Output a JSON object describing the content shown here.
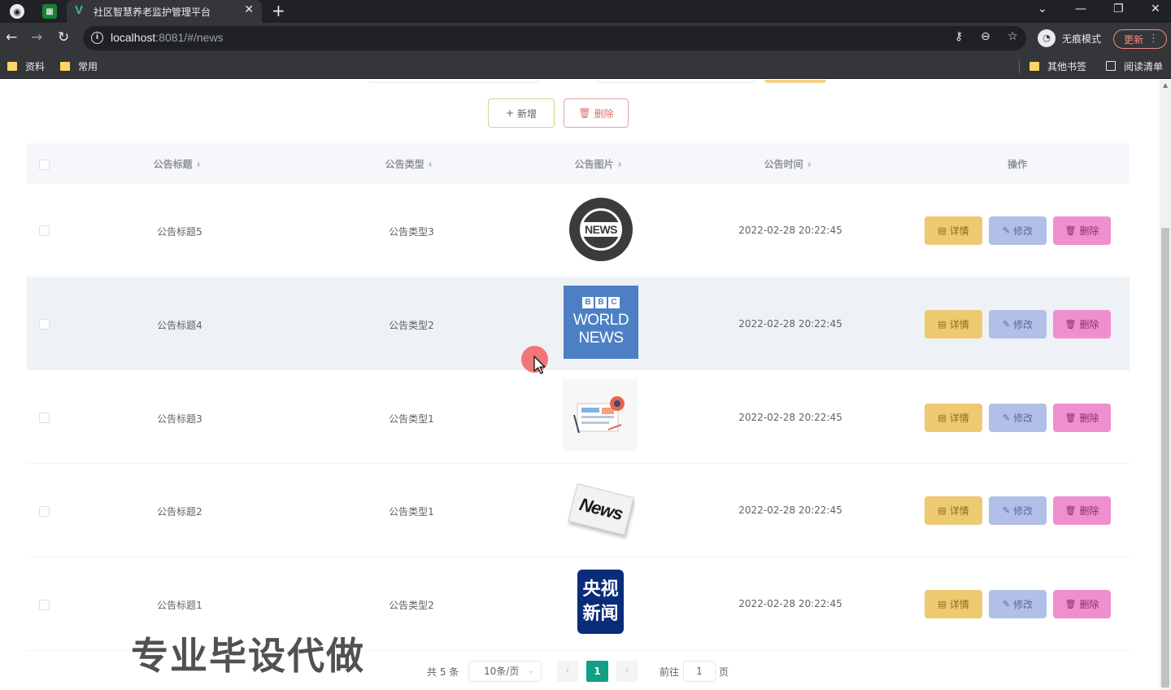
{
  "browser": {
    "tab_title": "社区智慧养老监护管理平台",
    "tab_close": "✕",
    "tab_new": "+",
    "url_host": "localhost",
    "url_rest": ":8081/#/news",
    "incognito_label": "无痕模式",
    "update_label": "更新",
    "bookmarks": [
      "资料",
      "常用"
    ],
    "bookmarks_right": [
      "其他书签",
      "阅读清单"
    ]
  },
  "toolbar": {
    "add_label": "新增",
    "delete_label": "删除"
  },
  "table": {
    "headers": [
      "公告标题",
      "公告类型",
      "公告图片",
      "公告时间",
      "操作"
    ],
    "rows": [
      {
        "title": "公告标题5",
        "type": "公告类型3",
        "image": "news-globe-image",
        "time": "2022-02-28 20:22:45"
      },
      {
        "title": "公告标题4",
        "type": "公告类型2",
        "image": "bbc-world-news-image",
        "time": "2022-02-28 20:22:45"
      },
      {
        "title": "公告标题3",
        "type": "公告类型1",
        "image": "newspaper-illustration-image",
        "time": "2022-02-28 20:22:45"
      },
      {
        "title": "公告标题2",
        "type": "公告类型1",
        "image": "news-3d-text-image",
        "time": "2022-02-28 20:22:45"
      },
      {
        "title": "公告标题1",
        "type": "公告类型2",
        "image": "cctv-news-image",
        "time": "2022-02-28 20:22:45"
      }
    ],
    "row_actions": [
      "详情",
      "修改",
      "删除"
    ]
  },
  "images": {
    "globe_text": "NEWS",
    "bbc_letters": [
      "B",
      "B",
      "C"
    ],
    "bbc_lines": [
      "WORLD",
      "NEWS"
    ],
    "news3d_text": "News",
    "cctv_lines": [
      "央视",
      "新闻"
    ]
  },
  "pagination": {
    "total_text": "共 5 条",
    "page_size": "10条/页",
    "prev": "‹",
    "next": "›",
    "current_page": "1",
    "goto_label": "前往",
    "goto_value": "1",
    "page_unit": "页"
  },
  "overlay": {
    "watermark": "专业毕设代做"
  },
  "colors": {
    "accent": "#12a085",
    "detail": "#edc96f",
    "edit": "#b2bfe6",
    "remove": "#f08fcf"
  }
}
